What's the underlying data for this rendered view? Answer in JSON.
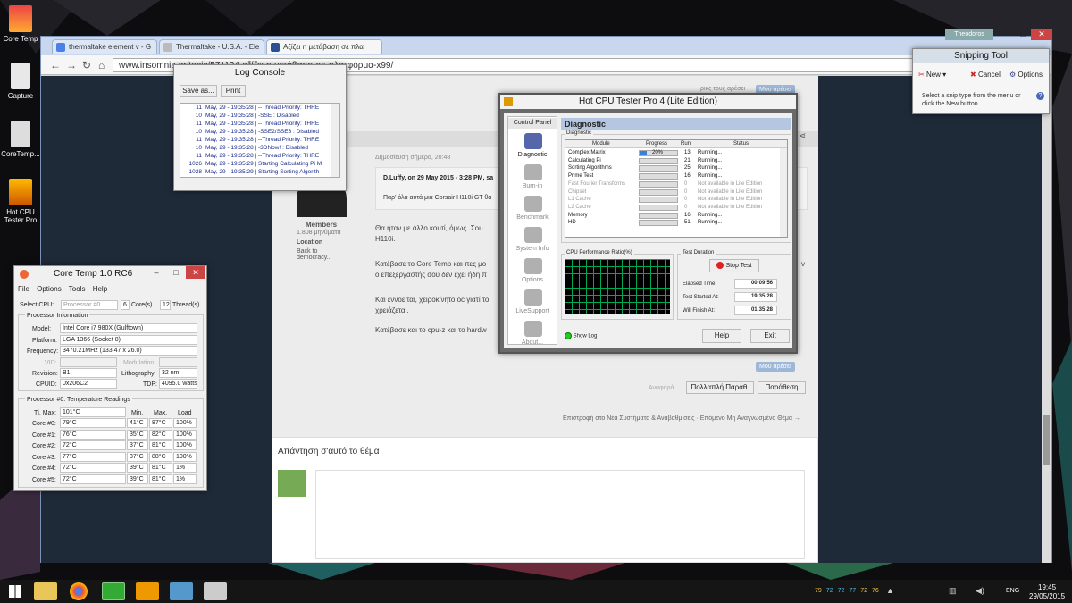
{
  "desktop": {
    "icons": [
      {
        "label": "Core Temp"
      },
      {
        "label": "Capture"
      },
      {
        "label": "CoreTemp..."
      },
      {
        "label": "Hot CPU Tester Pro"
      }
    ]
  },
  "chrome": {
    "tabs": [
      {
        "label": "thermaltake element v - G"
      },
      {
        "label": "Thermaltake - U.S.A. - Ele"
      },
      {
        "label": "Αξίζει η μετάβαση σε πλα"
      }
    ],
    "user": "Theodoros",
    "url": "www.insomnia.gr/topic/571124-αξίζει-η-μετάβαση-σε-πλατφόρμα-x99/"
  },
  "forum": {
    "members_label": "Members",
    "post_count": "1.808 μηνύματα",
    "location_label": "Location",
    "location_value": "Back to democracy...",
    "post_time": "Δημοσίευση σήμερα, 20:48",
    "quote_author": "D.Luffy, on 29 May 2015 - 3:28 PM, sa",
    "quote_text": "Παρ' όλα αυτά μια Corsair H110i GT θα",
    "p1a": "Θα ήταν με άλλο κουτί, όμως. Σου",
    "p1b": "H110i.",
    "p2a": "Κατέβασε το Core Temp και πες μο",
    "p2b": "ο επεξεργαστής σου δεν έχει ήδη π",
    "p2tail": "ν",
    "p3a": "Και εννοείται, χειροκίνητο οc γιατί το",
    "p3b": "χρειάζεται.",
    "p4": "Κατέβασε και το cpu-z και το hardw",
    "like_label": "Μου αρέσει",
    "top_like_text": "ρικς τους αρέσει",
    "report": "Αναφορά",
    "multiquote": "Πολλαπλή Παράθ.",
    "quote_btn": "Παράθεση",
    "nav_text": "Επιστροφή στο Νέα Συστήματα & Αναβαθμίσεις · Επόμενο Μη Αναγνωσμένο Θέμα →",
    "reply_title": "Απάντηση σ'αυτό το θέμα"
  },
  "log_console": {
    "title": "Log Console",
    "save_btn": "Save as...",
    "print_btn": "Print",
    "rows": [
      {
        "n": "11",
        "t": "May, 29 - 19:35:28 | --Thread Priority: THRE"
      },
      {
        "n": "10",
        "t": "May, 29 - 19:35:28 | -SSE : Disabled"
      },
      {
        "n": "11",
        "t": "May, 29 - 19:35:28 | --Thread Priority: THRE"
      },
      {
        "n": "10",
        "t": "May, 29 - 19:35:28 | -SSE2/SSE3 : Disabled"
      },
      {
        "n": "11",
        "t": "May, 29 - 19:35:28 | --Thread Priority: THRE"
      },
      {
        "n": "10",
        "t": "May, 29 - 19:35:28 | -3DNow! : Disabled"
      },
      {
        "n": "11",
        "t": "May, 29 - 19:35:28 | --Thread Priority: THRE"
      },
      {
        "n": "1026",
        "t": "May, 29 - 19:35:29 | Starting Calculating Pi M"
      },
      {
        "n": "1028",
        "t": "May, 29 - 19:35:29 | Starting Sorting Algorith"
      }
    ]
  },
  "coretemp": {
    "title": "Core Temp 1.0 RC6",
    "menu": [
      "File",
      "Options",
      "Tools",
      "Help"
    ],
    "select_cpu_label": "Select CPU:",
    "select_cpu_value": "Processor #0",
    "cores_count": "6",
    "cores_label": "Core(s)",
    "threads_count": "12",
    "threads_label": "Thread(s)",
    "info_title": "Processor Information",
    "model_label": "Model:",
    "model_value": "Intel Core i7 980X (Gulftown)",
    "platform_label": "Platform:",
    "platform_value": "LGA 1366 (Socket 8)",
    "freq_label": "Frequency:",
    "freq_value": "3470.21MHz (133.47 x 26.0)",
    "vid_label": "VID:",
    "modulation_label": "Modulation:",
    "revision_label": "Revision:",
    "revision_value": "B1",
    "litho_label": "Lithography:",
    "litho_value": "32 nm",
    "cpuid_label": "CPUID:",
    "cpuid_value": "0x206C2",
    "tdp_label": "TDP:",
    "tdp_value": "4095.0 watts",
    "temps_title": "Processor #0: Temperature Readings",
    "tjmax_label": "Tj. Max:",
    "tjmax_value": "101°C",
    "col_min": "Min.",
    "col_max": "Max.",
    "col_load": "Load",
    "cores": [
      {
        "name": "Core #0:",
        "temp": "79°C",
        "min": "41°C",
        "max": "87°C",
        "load": "100%"
      },
      {
        "name": "Core #1:",
        "temp": "76°C",
        "min": "35°C",
        "max": "82°C",
        "load": "100%"
      },
      {
        "name": "Core #2:",
        "temp": "72°C",
        "min": "37°C",
        "max": "81°C",
        "load": "100%"
      },
      {
        "name": "Core #3:",
        "temp": "77°C",
        "min": "37°C",
        "max": "88°C",
        "load": "100%"
      },
      {
        "name": "Core #4:",
        "temp": "72°C",
        "min": "39°C",
        "max": "81°C",
        "load": "1%"
      },
      {
        "name": "Core #5:",
        "temp": "72°C",
        "min": "39°C",
        "max": "81°C",
        "load": "1%"
      }
    ]
  },
  "hotcpu": {
    "title": "Hot CPU Tester Pro 4 (Lite Edition)",
    "panel_title": "Control Panel",
    "nav": [
      {
        "label": "Diagnostic",
        "color": "#5566aa"
      },
      {
        "label": "Burn-in",
        "color": "#b0b0b0"
      },
      {
        "label": "Benchmark",
        "color": "#b0b0b0"
      },
      {
        "label": "System Info",
        "color": "#b0b0b0"
      },
      {
        "label": "Options",
        "color": "#b0b0b0"
      },
      {
        "label": "LiveSupport",
        "color": "#b0b0b0"
      },
      {
        "label": "About...",
        "color": "#b0b0b0"
      }
    ],
    "header": "Diagnostic",
    "group_label": "Diagnostic",
    "cols": {
      "module": "Module",
      "progress": "Progress",
      "run": "Run",
      "status": "Status"
    },
    "modules": [
      {
        "name": "Complex Matrix",
        "progress_pct": 20,
        "progress_text": "20%",
        "run": "13",
        "status": "Running...",
        "enabled": true
      },
      {
        "name": "Calculating Pi",
        "progress_pct": 0,
        "progress_text": "",
        "run": "21",
        "status": "Running...",
        "enabled": true
      },
      {
        "name": "Sorting Algorithms",
        "progress_pct": 0,
        "progress_text": "",
        "run": "25",
        "status": "Running...",
        "enabled": true
      },
      {
        "name": "Prime Test",
        "progress_pct": 0,
        "progress_text": "",
        "run": "16",
        "status": "Running...",
        "enabled": true
      },
      {
        "name": "Fast Fourier Transforms",
        "progress_pct": 0,
        "progress_text": "",
        "run": "0",
        "status": "Not available in Lite Edition",
        "enabled": false
      },
      {
        "name": "Chipset",
        "progress_pct": 0,
        "progress_text": "",
        "run": "0",
        "status": "Not available in Lite Edition",
        "enabled": false
      },
      {
        "name": "L1 Cache",
        "progress_pct": 0,
        "progress_text": "",
        "run": "0",
        "status": "Not available in Lite Edition",
        "enabled": false
      },
      {
        "name": "L2 Cache",
        "progress_pct": 0,
        "progress_text": "",
        "run": "0",
        "status": "Not available in Lite Edition",
        "enabled": false
      },
      {
        "name": "Memory",
        "progress_pct": 0,
        "progress_text": "",
        "run": "16",
        "status": "Running...",
        "enabled": true
      },
      {
        "name": "HD",
        "progress_pct": 0,
        "progress_text": "",
        "run": "51",
        "status": "Running...",
        "enabled": true
      }
    ],
    "perf_label": "CPU Performance Ratio(%)",
    "duration_label": "Test Duration",
    "stop_btn": "Stop Test",
    "elapsed_label": "Elapsed Time:",
    "elapsed_value": "00:09:56",
    "started_label": "Test Started At:",
    "started_value": "19:35:28",
    "finish_label": "Will Finish At:",
    "finish_value": "01:35:28",
    "show_log": "Show Log",
    "help_btn": "Help",
    "exit_btn": "Exit"
  },
  "snipping": {
    "title": "Snipping Tool",
    "new_btn": "New",
    "cancel_btn": "Cancel",
    "options_btn": "Options",
    "hint": "Select a snip type from the menu or click the New button."
  },
  "taskbar": {
    "tray_temps": [
      "79",
      "72",
      "72",
      "77",
      "72",
      "76"
    ],
    "lang": "ENG",
    "time": "19:45",
    "date": "29/05/2015"
  }
}
